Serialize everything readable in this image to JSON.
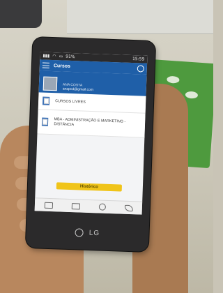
{
  "status": {
    "time": "15:59",
    "battery": "91%"
  },
  "app": {
    "title": "Cursos"
  },
  "profile": {
    "name": "ANA COSTA",
    "email": "anapcd@gmail.com"
  },
  "courses": [
    {
      "label": "CURSOS LIVRES"
    },
    {
      "label": "MBA - ADMINISTRAÇÃO E MARKETING - DISTÂNCIA"
    }
  ],
  "cta": {
    "label": "Histórico"
  },
  "device": {
    "brand": "LG"
  },
  "colors": {
    "appbar": "#1f5fa8",
    "cta": "#f0c419"
  }
}
